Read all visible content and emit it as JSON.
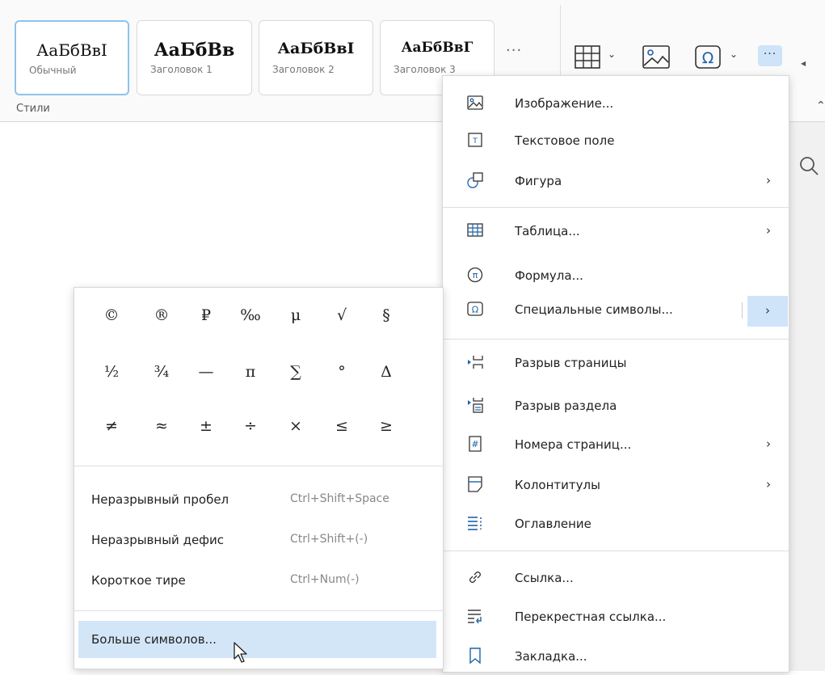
{
  "styles": {
    "group_label": "Стили",
    "more_glyph": "···",
    "items": [
      {
        "preview": "АаБбВвІ",
        "name": "Обычный"
      },
      {
        "preview": "АаБбВв",
        "name": "Заголовок 1"
      },
      {
        "preview": "АаБбВвІ",
        "name": "Заголовок 2"
      },
      {
        "preview": "АаБбВвГ",
        "name": "Заголовок 3"
      }
    ]
  },
  "toolbar": {
    "more_glyph": "···",
    "icons": [
      "table-icon",
      "image-icon",
      "special-character-icon",
      "more-icon"
    ]
  },
  "insert_menu": {
    "items": [
      {
        "label": "Изображение...",
        "icon": "image-icon"
      },
      {
        "label": "Текстовое поле",
        "icon": "text-box-icon"
      },
      {
        "label": "Фигура",
        "icon": "shape-icon",
        "submenu": true
      },
      {
        "label": "Таблица...",
        "icon": "table-icon",
        "submenu": true
      },
      {
        "label": "Формула...",
        "icon": "formula-icon",
        "glyph": "π"
      },
      {
        "label": "Специальные символы...",
        "icon": "special-character-icon",
        "glyph": "Ω",
        "submenu": true,
        "selected": true
      },
      {
        "label": "Разрыв страницы",
        "icon": "page-break-icon"
      },
      {
        "label": "Разрыв раздела",
        "icon": "section-break-icon"
      },
      {
        "label": "Номера страниц...",
        "icon": "page-numbers-icon",
        "glyph": "#",
        "submenu": true
      },
      {
        "label": "Колонтитулы",
        "icon": "header-footer-icon",
        "submenu": true
      },
      {
        "label": "Оглавление",
        "icon": "table-of-contents-icon"
      },
      {
        "label": "Ссылка...",
        "icon": "link-icon"
      },
      {
        "label": "Перекрестная ссылка...",
        "icon": "cross-reference-icon"
      },
      {
        "label": "Закладка...",
        "icon": "bookmark-icon"
      }
    ],
    "arrow_glyph": "›"
  },
  "symbols_menu": {
    "grid": [
      [
        "©",
        "®",
        "₽",
        "‰",
        "μ",
        "√",
        "§"
      ],
      [
        "½",
        "¾",
        "—",
        "π",
        "∑",
        "°",
        "Δ"
      ],
      [
        "≠",
        "≈",
        "±",
        "÷",
        "×",
        "≤",
        "≥"
      ]
    ],
    "commands": [
      {
        "label": "Неразрывный пробел",
        "shortcut": "Ctrl+Shift+Space"
      },
      {
        "label": "Неразрывный дефис",
        "shortcut": "Ctrl+Shift+(-)"
      },
      {
        "label": "Короткое тире",
        "shortcut": "Ctrl+Num(-)"
      }
    ],
    "more_label": "Больше символов..."
  },
  "colors": {
    "accent_highlight": "#cfe4f9",
    "active_style_border": "#8ec3ee",
    "icon_blue": "#1f62a8"
  }
}
